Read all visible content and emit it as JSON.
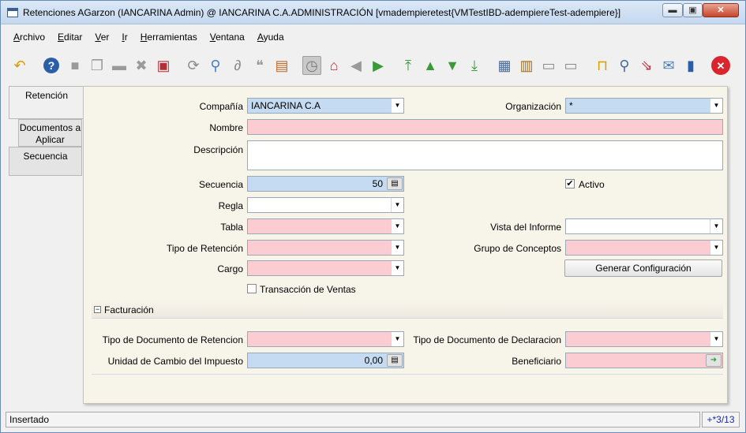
{
  "window": {
    "title": "Retenciones  AGarzon (IANCARINA Admin) @ IANCARINA C.A.ADMINISTRACIÓN [vmadempieretest{VMTestIBD-adempiereTest-adempiere}]",
    "min_glyph": "▬",
    "max_glyph": "▣",
    "close_glyph": "✕"
  },
  "menu": [
    "Archivo",
    "Editar",
    "Ver",
    "Ir",
    "Herramientas",
    "Ventana",
    "Ayuda"
  ],
  "toolbar": {
    "icons": [
      {
        "name": "undo-icon",
        "glyph": "↶",
        "color": "#d89a00"
      },
      {
        "name": "help-icon",
        "glyph": "?",
        "color": "#2a5fa8"
      },
      {
        "name": "new-record-icon",
        "glyph": "■",
        "color": "#9a9a9a"
      },
      {
        "name": "copy-record-icon",
        "glyph": "❐",
        "color": "#9a9a9a"
      },
      {
        "name": "delete-icon",
        "glyph": "▬",
        "color": "#9a9a9a"
      },
      {
        "name": "delete-selection-icon",
        "glyph": "✖",
        "color": "#9a9a9a"
      },
      {
        "name": "save-icon",
        "glyph": "▣",
        "color": "#b0303a"
      },
      {
        "name": "refresh-icon",
        "glyph": "⟳",
        "color": "#8a8a8a"
      },
      {
        "name": "find-icon",
        "glyph": "⚲",
        "color": "#4a7fb8"
      },
      {
        "name": "attachment-icon",
        "glyph": "∂",
        "color": "#8a8a8a"
      },
      {
        "name": "chat-icon",
        "glyph": "❝",
        "color": "#9a9a9a"
      },
      {
        "name": "grid-toggle-icon",
        "glyph": "▤",
        "color": "#c06a2a"
      },
      {
        "name": "history-icon",
        "glyph": "◷",
        "color": "#7a7a7a"
      },
      {
        "name": "home-icon",
        "glyph": "⌂",
        "color": "#c0303a"
      },
      {
        "name": "back-icon",
        "glyph": "◀",
        "color": "#9a9a9a"
      },
      {
        "name": "forward-icon",
        "glyph": "▶",
        "color": "#3a9a3a"
      },
      {
        "name": "first-record-icon",
        "glyph": "⤒",
        "color": "#3a9a3a"
      },
      {
        "name": "previous-record-icon",
        "glyph": "▲",
        "color": "#3a9a3a"
      },
      {
        "name": "next-record-icon",
        "glyph": "▼",
        "color": "#3a9a3a"
      },
      {
        "name": "last-record-icon",
        "glyph": "⤓",
        "color": "#3a9a3a"
      },
      {
        "name": "report-icon",
        "glyph": "▦",
        "color": "#4a6a9a"
      },
      {
        "name": "archive-icon",
        "glyph": "▥",
        "color": "#a0701a"
      },
      {
        "name": "print-preview-icon",
        "glyph": "▭",
        "color": "#8a8a8a"
      },
      {
        "name": "print-icon",
        "glyph": "▭",
        "color": "#8a8a8a"
      },
      {
        "name": "lock-icon",
        "glyph": "⊓",
        "color": "#d8a000"
      },
      {
        "name": "zoom-across-icon",
        "glyph": "⚲",
        "color": "#4a6a9a"
      },
      {
        "name": "active-workflows-icon",
        "glyph": "⇘",
        "color": "#c0303a"
      },
      {
        "name": "request-icon",
        "glyph": "✉",
        "color": "#4a7fb8"
      },
      {
        "name": "product-info-icon",
        "glyph": "▮",
        "color": "#2a5fa8"
      },
      {
        "name": "exit-icon",
        "glyph": "✕",
        "color": "#ffffff"
      }
    ]
  },
  "tabs": [
    {
      "label": "Retención"
    },
    {
      "label": "Documentos a Aplicar"
    },
    {
      "label": "Secuencia"
    }
  ],
  "form": {
    "compania": {
      "label": "Compañía",
      "value": "IANCARINA C.A"
    },
    "organizacion": {
      "label": "Organización",
      "value": "*"
    },
    "nombre": {
      "label": "Nombre",
      "value": ""
    },
    "descripcion": {
      "label": "Descripción",
      "value": ""
    },
    "secuencia": {
      "label": "Secuencia",
      "value": "50"
    },
    "activo": {
      "label": "Activo",
      "checked": true
    },
    "regla": {
      "label": "Regla",
      "value": ""
    },
    "tabla": {
      "label": "Tabla",
      "value": ""
    },
    "vista_informe": {
      "label": "Vista del Informe",
      "value": ""
    },
    "tipo_retencion": {
      "label": "Tipo de Retención",
      "value": ""
    },
    "grupo_conceptos": {
      "label": "Grupo de Conceptos",
      "value": ""
    },
    "cargo": {
      "label": "Cargo",
      "value": ""
    },
    "generar_button": "Generar Configuración",
    "transaccion_ventas": {
      "label": "Transacción de Ventas",
      "checked": false
    }
  },
  "facturacion": {
    "section_title": "Facturación",
    "toggle_glyph": "−",
    "tipo_doc_retencion": {
      "label": "Tipo de Documento de Retencion",
      "value": ""
    },
    "tipo_doc_declaracion": {
      "label": "Tipo de Documento de Declaracion",
      "value": ""
    },
    "unidad_cambio": {
      "label": "Unidad de Cambio del Impuesto",
      "value": "0,00"
    },
    "beneficiario": {
      "label": "Beneficiario",
      "value": ""
    }
  },
  "status": {
    "message": "Insertado",
    "record_info": "+*3/13"
  }
}
